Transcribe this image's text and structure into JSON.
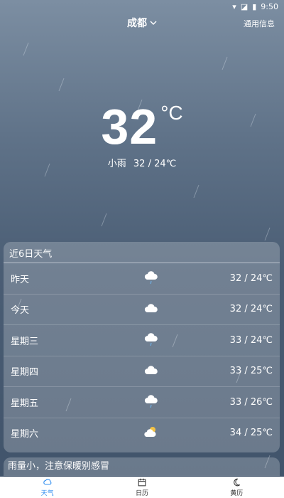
{
  "status": {
    "time": "9:50"
  },
  "header": {
    "city": "成都",
    "general_info": "通用信息"
  },
  "current": {
    "temp": "32",
    "unit": "°C",
    "condition": "小雨",
    "range": "32 / 24℃"
  },
  "forecast": {
    "title": "近6日天气",
    "days": [
      {
        "day": "昨天",
        "icon": "cloud-rain-icon",
        "range": "32 / 24℃"
      },
      {
        "day": "今天",
        "icon": "cloud-icon",
        "range": "32 / 24℃"
      },
      {
        "day": "星期三",
        "icon": "cloud-rain-icon",
        "range": "33 / 24℃"
      },
      {
        "day": "星期四",
        "icon": "cloud-icon",
        "range": "33 / 25℃"
      },
      {
        "day": "星期五",
        "icon": "cloud-rain-icon",
        "range": "33 / 26℃"
      },
      {
        "day": "星期六",
        "icon": "sun-cloud-icon",
        "range": "34 / 25℃"
      }
    ]
  },
  "tip": "雨量小，注意保暖别感冒",
  "nav": [
    {
      "label": "天气",
      "active": true
    },
    {
      "label": "日历",
      "active": false
    },
    {
      "label": "黄历",
      "active": false
    }
  ]
}
